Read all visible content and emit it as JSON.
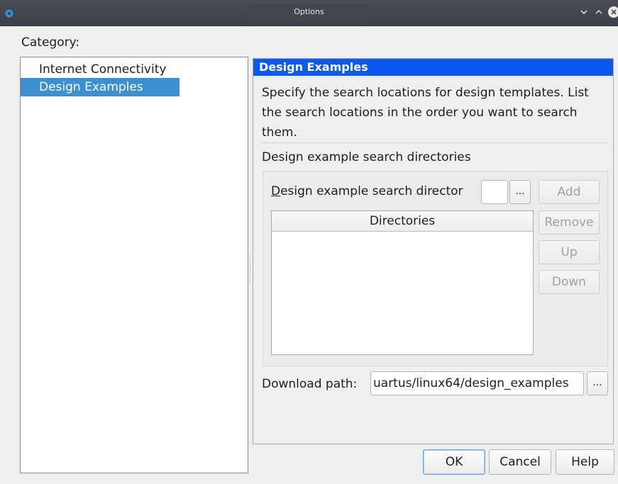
{
  "window": {
    "title": "Options"
  },
  "category": {
    "label": "Category:",
    "items": [
      {
        "label": "Internet Connectivity",
        "selected": false
      },
      {
        "label": "Design Examples",
        "selected": true
      }
    ]
  },
  "panel": {
    "header": "Design Examples",
    "description": "Specify the search locations for design templates. List the search locations in the order you want to search them.",
    "section_title": "Design example search directories",
    "dir_label_first": "D",
    "dir_label_rest": "esign example search director",
    "dir_input_value": "",
    "browse_label": "...",
    "buttons": {
      "add": "Add",
      "remove": "Remove",
      "up": "Up",
      "down": "Down"
    },
    "table": {
      "column": "Directories",
      "rows": []
    },
    "download_label": "Download path:",
    "download_value": "uartus/linux64/design_examples"
  },
  "footer": {
    "ok": "OK",
    "cancel": "Cancel",
    "help": "Help"
  },
  "colors": {
    "accent": "#0a59f0",
    "selection": "#3c8fd1",
    "titlebar": "#3f4349"
  }
}
